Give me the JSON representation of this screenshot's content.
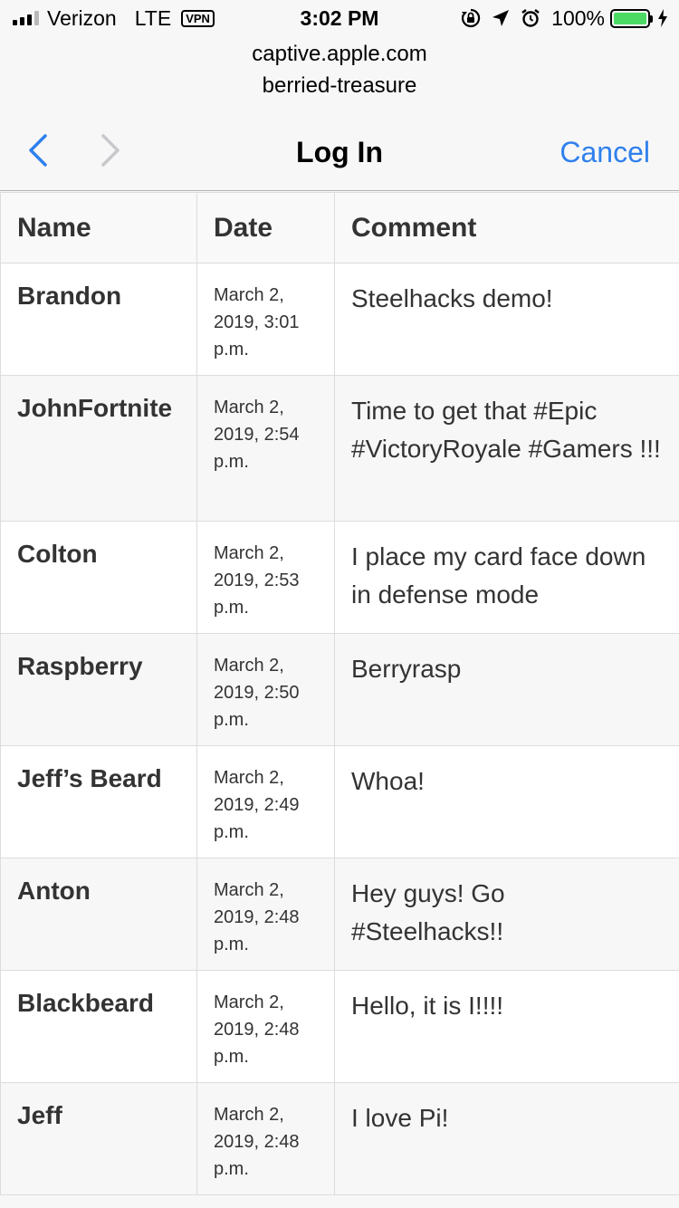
{
  "status_bar": {
    "carrier": "Verizon",
    "network": "LTE",
    "vpn": "VPN",
    "time": "3:02 PM",
    "battery_percent": "100%",
    "battery_level": 1.0,
    "battery_color": "#4cd964",
    "icons": [
      "orientation-lock-icon",
      "location-icon",
      "alarm-icon",
      "charging-icon"
    ]
  },
  "header": {
    "host": "captive.apple.com",
    "page": "berried-treasure",
    "title": "Log In",
    "cancel_label": "Cancel",
    "accent_color": "#2f80ed"
  },
  "table": {
    "columns": [
      "Name",
      "Date",
      "Comment"
    ],
    "rows": [
      {
        "name": "Brandon",
        "date": "March 2, 2019, 3:01 p.m.",
        "comment": "Steelhacks demo!"
      },
      {
        "name": "JohnFortnite",
        "date": "March 2, 2019, 2:54 p.m.",
        "comment": "Time to get that #Epic #VictoryRoyale #Gamers !!!"
      },
      {
        "name": "Colton",
        "date": "March 2, 2019, 2:53 p.m.",
        "comment": "I place my card face down in defense mode"
      },
      {
        "name": "Raspberry",
        "date": "March 2, 2019, 2:50 p.m.",
        "comment": "Berryrasp"
      },
      {
        "name": "Jeff’s Beard",
        "date": "March 2, 2019, 2:49 p.m.",
        "comment": "Whoa!"
      },
      {
        "name": "Anton",
        "date": "March 2, 2019, 2:48 p.m.",
        "comment": "Hey guys! Go #Steelhacks!!"
      },
      {
        "name": "Blackbeard",
        "date": "March 2, 2019, 2:48 p.m.",
        "comment": "Hello, it is I!!!!"
      },
      {
        "name": "Jeff",
        "date": "March 2, 2019, 2:48 p.m.",
        "comment": "I love Pi!"
      }
    ]
  }
}
